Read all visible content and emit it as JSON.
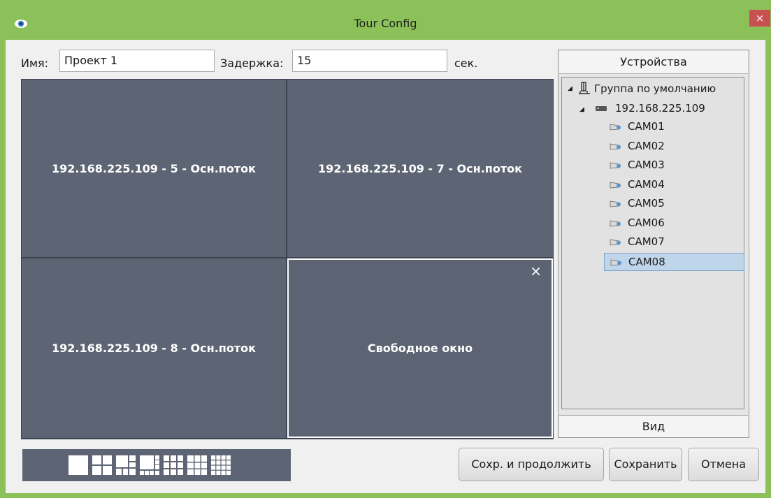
{
  "window": {
    "title": "Tour Config",
    "close_label": "×"
  },
  "form": {
    "name_label": "Имя:",
    "name_value": "Проект 1",
    "delay_label": "Задержка:",
    "delay_value": "15",
    "delay_unit": "сек."
  },
  "grid": {
    "cells": [
      "192.168.225.109 - 5 - Осн.поток",
      "192.168.225.109 - 7 - Осн.поток",
      "192.168.225.109 - 8 - Осн.поток",
      "Свободное окно"
    ],
    "cell_close": "×"
  },
  "layouts": [
    "1x1",
    "2x2",
    "1+5",
    "1+7",
    "3x3",
    "4x4 alt",
    "4x4"
  ],
  "devices": {
    "header": "Устройства",
    "group": "Группа по умолчанию",
    "device": "192.168.225.109",
    "cameras": [
      "CAM01",
      "CAM02",
      "CAM03",
      "CAM04",
      "CAM05",
      "CAM06",
      "CAM07",
      "CAM08"
    ],
    "selected": "CAM08",
    "view_label": "Вид"
  },
  "buttons": {
    "save_continue": "Сохр. и продолжить",
    "save": "Сохранить",
    "cancel": "Отмена"
  }
}
